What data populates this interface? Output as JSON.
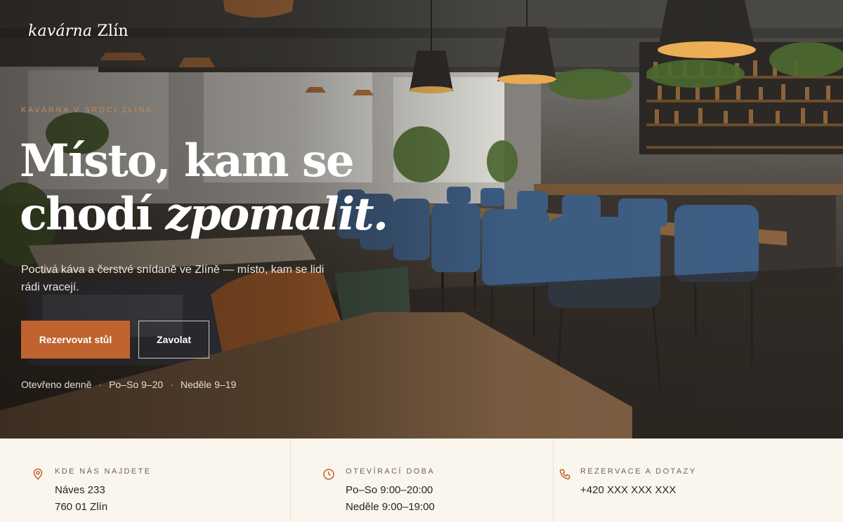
{
  "brand": {
    "name_italic": "kavárna",
    "name_regular": "Zlín"
  },
  "hero": {
    "eyebrow": "Kavárna v srdci Zlína",
    "headline_line1": "Místo, kam se",
    "headline_line2_regular": "chodí",
    "headline_line2_italic": "zpomalit.",
    "lead": "Poctivá káva a čerstvé snídaně ve Zlíně — místo, kam se lidi rádi vracejí.",
    "primary_button": "Rezervovat stůl",
    "secondary_button": "Zavolat",
    "hours": [
      "Otevřeno denně",
      "Po–So 9–20",
      "Neděle 9–19"
    ],
    "separator": "·"
  },
  "info": {
    "location": {
      "title": "Kde nás najdete",
      "line1": "Náves 233",
      "line2": "760 01 Zlín",
      "icon": "map-pin-icon"
    },
    "hours": {
      "title": "Otevírací doba",
      "line1": "Po–So 9:00–20:00",
      "line2": "Neděle 9:00–19:00",
      "icon": "clock-icon"
    },
    "contact": {
      "title": "Rezervace a dotazy",
      "line1": "+420 XXX XXX XXX",
      "icon": "phone-icon"
    }
  },
  "colors": {
    "accent": "#c0632f",
    "eyebrow": "#c98a55",
    "strip_bg": "#faf6ee"
  }
}
